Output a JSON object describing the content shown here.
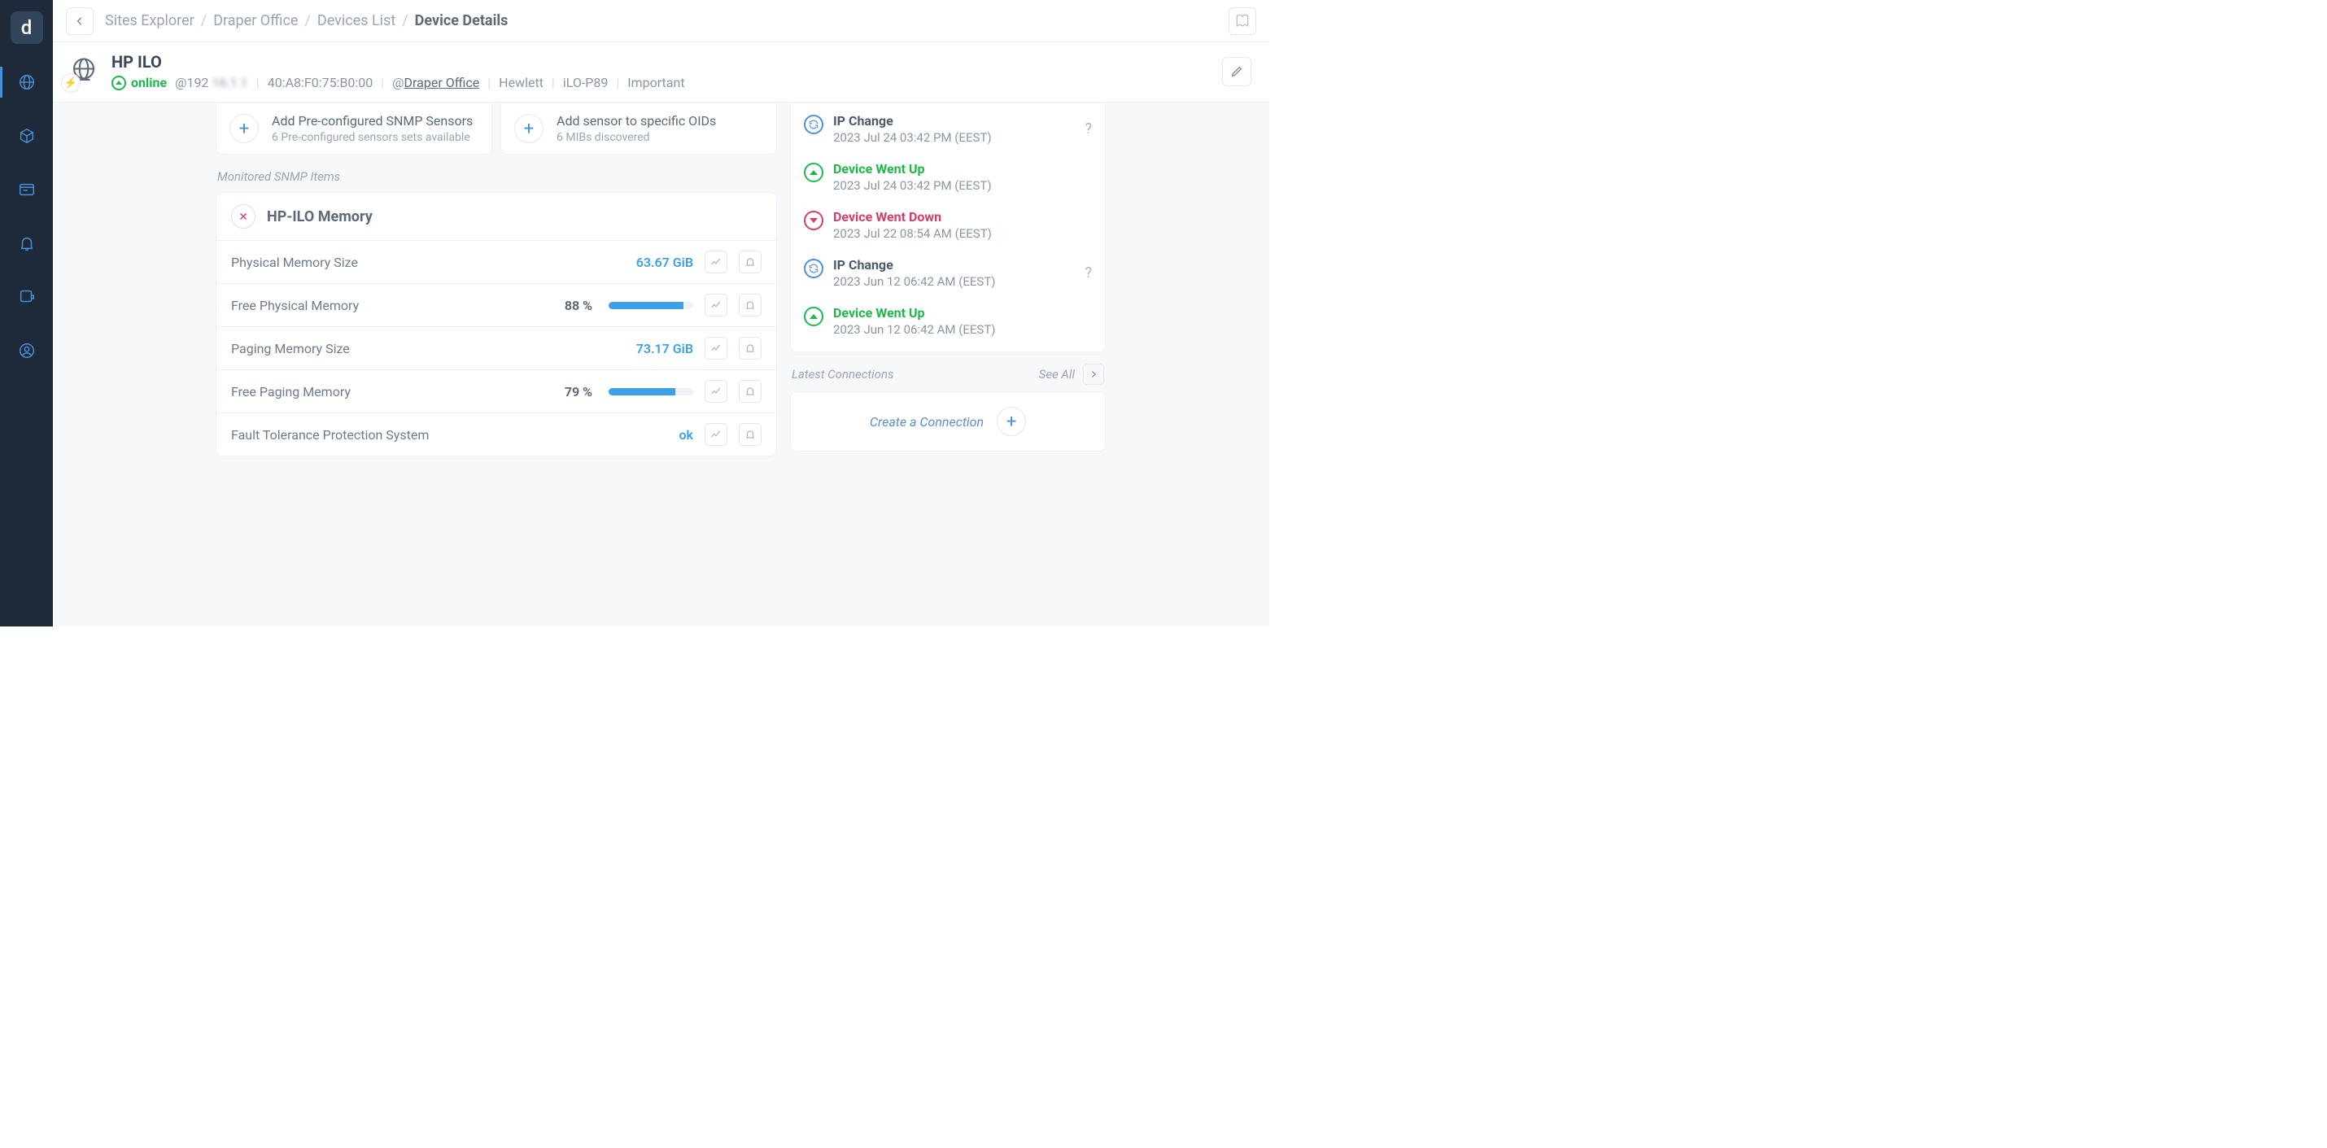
{
  "breadcrumbs": [
    "Sites Explorer",
    "Draper Office",
    "Devices List",
    "Device Details"
  ],
  "device": {
    "title": "HP ILO",
    "status": "online",
    "ip_prefix": "@192",
    "ip_blur": "16.1.1",
    "mac": "40:A8:F0:75:B0:00",
    "site_prefix": "@",
    "site": "Draper Office",
    "vendor": "Hewlett",
    "model": "iLO-P89",
    "priority": "Important"
  },
  "actions": {
    "preconf_title": "Add Pre-configured SNMP Sensors",
    "preconf_sub": "6 Pre-configured sensors sets available",
    "oid_title": "Add sensor to specific OIDs",
    "oid_sub": "6 MIBs discovered"
  },
  "monitored_label": "Monitored SNMP Items",
  "snmp": {
    "group": "HP-ILO Memory",
    "metrics": [
      {
        "label": "Physical Memory Size",
        "value": "63.67 GiB"
      },
      {
        "label": "Free Physical Memory",
        "pct": "88 %",
        "fill": 88
      },
      {
        "label": "Paging Memory Size",
        "value": "73.17 GiB"
      },
      {
        "label": "Free Paging Memory",
        "pct": "79 %",
        "fill": 79
      },
      {
        "label": "Fault Tolerance Protection System",
        "value": "ok"
      }
    ]
  },
  "events": [
    {
      "type": "ip",
      "title": "IP Change",
      "ts": "2023 Jul 24 03:42 PM (EEST)",
      "q": true
    },
    {
      "type": "up",
      "title": "Device Went Up",
      "ts": "2023 Jul 24 03:42 PM (EEST)"
    },
    {
      "type": "down",
      "title": "Device Went Down",
      "ts": "2023 Jul 22 08:54 AM (EEST)"
    },
    {
      "type": "ip",
      "title": "IP Change",
      "ts": "2023 Jun 12 06:42 AM (EEST)",
      "q": true
    },
    {
      "type": "up",
      "title": "Device Went Up",
      "ts": "2023 Jun 12 06:42 AM (EEST)"
    }
  ],
  "connections": {
    "header": "Latest Connections",
    "see_all": "See All",
    "create": "Create a Connection"
  }
}
